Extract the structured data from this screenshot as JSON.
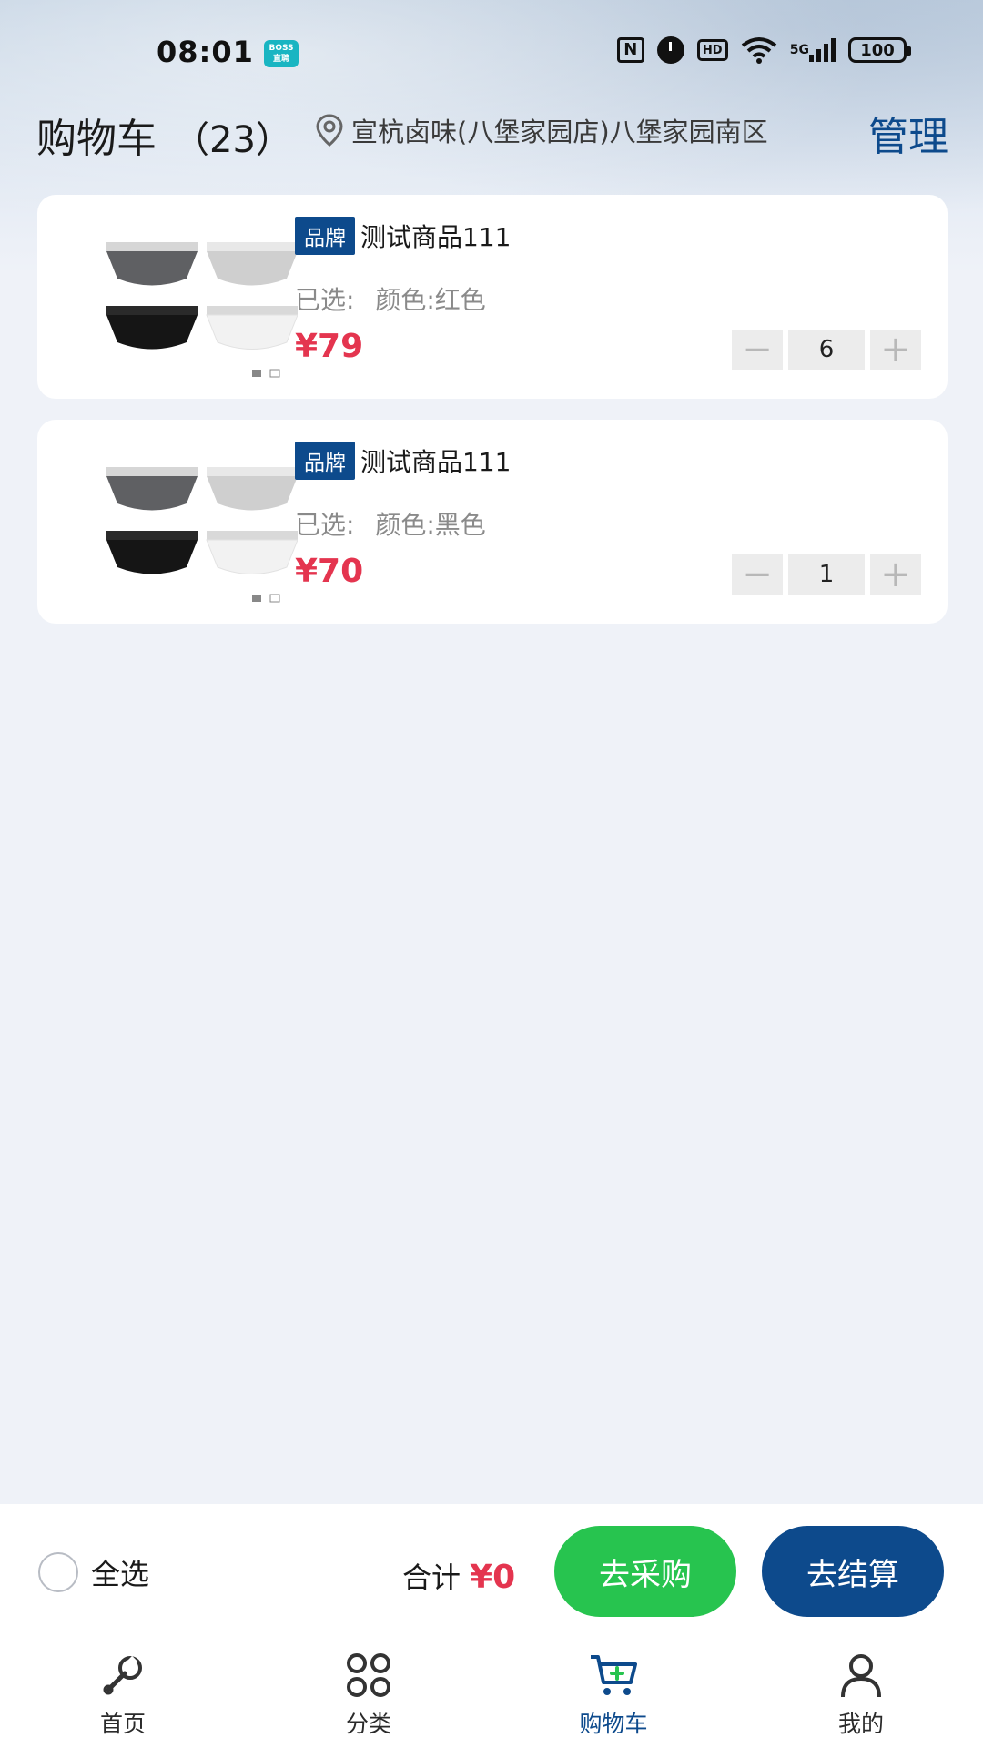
{
  "status_bar": {
    "time": "08:01",
    "app_badge": "BOSS\n直聘",
    "hd": "HD",
    "network": "5G",
    "battery": "100"
  },
  "header": {
    "title": "购物车",
    "count": "（23）",
    "location": "宣杭卤味(八堡家园店)八堡家园南区",
    "manage": "管理"
  },
  "cart": {
    "items": [
      {
        "brand_tag": "品牌",
        "name": "测试商品111",
        "variant_label": "已选:",
        "variant_value": "颜色:红色",
        "price": "¥79",
        "quantity": "6"
      },
      {
        "brand_tag": "品牌",
        "name": "测试商品111",
        "variant_label": "已选:",
        "variant_value": "颜色:黑色",
        "price": "¥70",
        "quantity": "1"
      }
    ]
  },
  "action_bar": {
    "select_all": "全选",
    "total_label": "合计",
    "total_amount": "¥0",
    "purchase_button": "去采购",
    "checkout_button": "去结算"
  },
  "tabs": [
    {
      "label": "首页",
      "icon": "wrench-icon"
    },
    {
      "label": "分类",
      "icon": "category-grid-icon"
    },
    {
      "label": "购物车",
      "icon": "cart-icon",
      "active": true
    },
    {
      "label": "我的",
      "icon": "user-icon"
    }
  ],
  "colors": {
    "brand_blue": "#0d4a8c",
    "price_red": "#e4354f",
    "green": "#27c44f",
    "background": "#eff2f8"
  }
}
